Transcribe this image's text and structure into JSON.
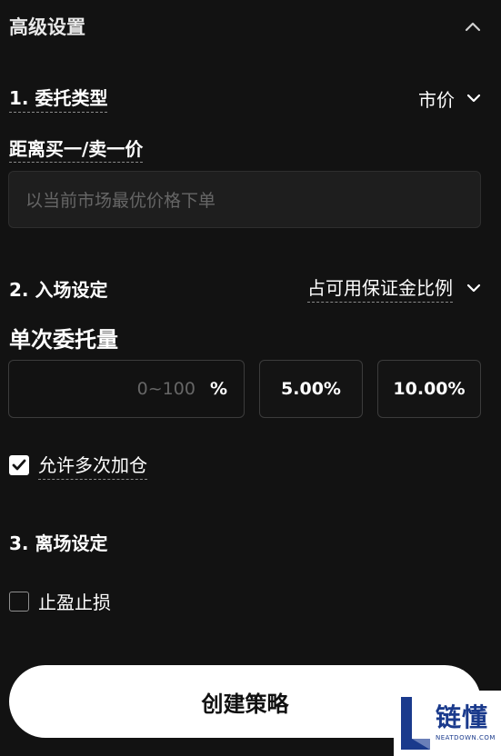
{
  "header": {
    "title": "高级设置"
  },
  "section1": {
    "label": "1. 委托类型",
    "order_type_value": "市价",
    "distance_label": "距离买一/卖一价",
    "input_placeholder": "以当前市场最优价格下单"
  },
  "section2": {
    "label": "2. 入场设定",
    "mode_value": "占可用保证金比例",
    "qty_label": "单次委托量",
    "qty_placeholder": "0~100",
    "qty_unit": "%",
    "preset_1": "5.00%",
    "preset_2": "10.00%",
    "allow_add": {
      "label": "允许多次加仓",
      "checked": true
    }
  },
  "section3": {
    "label": "3. 离场设定",
    "tp_sl": {
      "label": "止盈止损",
      "checked": false
    }
  },
  "footer": {
    "create_label": "创建策略"
  },
  "watermark": {
    "cn": "链懂",
    "en": "NEATDOWN.COM"
  },
  "colors": {
    "background": "#121212",
    "button": "#ffffff",
    "logo_blue": "#1a3a8c"
  }
}
